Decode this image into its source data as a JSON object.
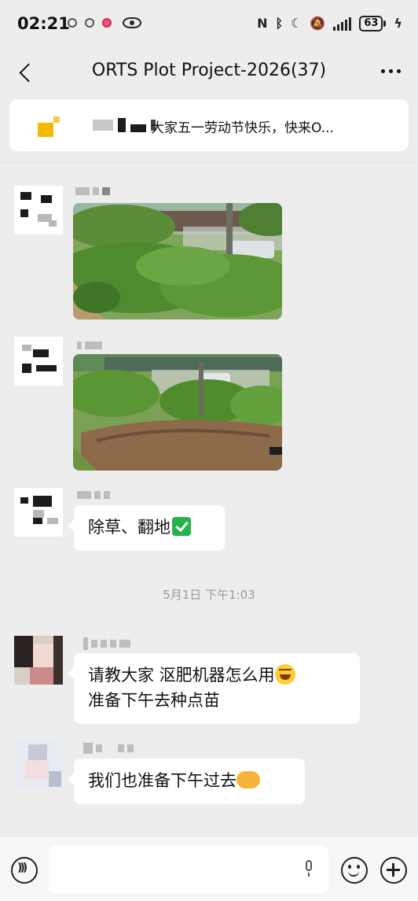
{
  "status_bar": {
    "time": "02:21",
    "battery": "63",
    "icons": [
      "nfc-icon",
      "bluetooth-icon",
      "moon-icon",
      "mute-icon",
      "signal-icon",
      "battery-icon",
      "charging-icon"
    ]
  },
  "header": {
    "title": "ORTS Plot Project-2026(37)"
  },
  "pinned": {
    "text": "大家五一劳动节快乐，快来O..."
  },
  "messages": [
    {
      "type": "image",
      "description_icon": "garden-photo-weeds"
    },
    {
      "type": "image",
      "description_icon": "garden-photo-tilled"
    },
    {
      "type": "text",
      "text": "除草、翻地"
    }
  ],
  "timestamp": "5月1日 下午1:03",
  "messages2": [
    {
      "type": "text",
      "line1": "请教大家 沤肥机器怎么用",
      "line2": "准备下午去种点苗"
    },
    {
      "type": "text",
      "text": "我们也准备下午过去"
    }
  ],
  "input": {
    "value": "",
    "placeholder": ""
  }
}
